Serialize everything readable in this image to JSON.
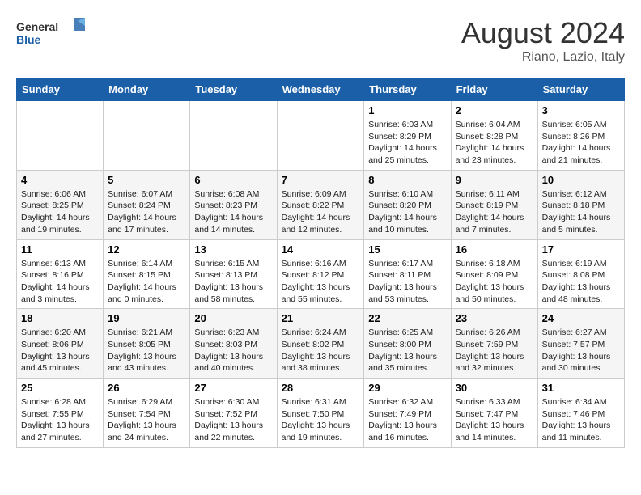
{
  "header": {
    "logo_general": "General",
    "logo_blue": "Blue",
    "month_title": "August 2024",
    "location": "Riano, Lazio, Italy"
  },
  "weekdays": [
    "Sunday",
    "Monday",
    "Tuesday",
    "Wednesday",
    "Thursday",
    "Friday",
    "Saturday"
  ],
  "weeks": [
    [
      {
        "day": "",
        "info": ""
      },
      {
        "day": "",
        "info": ""
      },
      {
        "day": "",
        "info": ""
      },
      {
        "day": "",
        "info": ""
      },
      {
        "day": "1",
        "info": "Sunrise: 6:03 AM\nSunset: 8:29 PM\nDaylight: 14 hours and 25 minutes."
      },
      {
        "day": "2",
        "info": "Sunrise: 6:04 AM\nSunset: 8:28 PM\nDaylight: 14 hours and 23 minutes."
      },
      {
        "day": "3",
        "info": "Sunrise: 6:05 AM\nSunset: 8:26 PM\nDaylight: 14 hours and 21 minutes."
      }
    ],
    [
      {
        "day": "4",
        "info": "Sunrise: 6:06 AM\nSunset: 8:25 PM\nDaylight: 14 hours and 19 minutes."
      },
      {
        "day": "5",
        "info": "Sunrise: 6:07 AM\nSunset: 8:24 PM\nDaylight: 14 hours and 17 minutes."
      },
      {
        "day": "6",
        "info": "Sunrise: 6:08 AM\nSunset: 8:23 PM\nDaylight: 14 hours and 14 minutes."
      },
      {
        "day": "7",
        "info": "Sunrise: 6:09 AM\nSunset: 8:22 PM\nDaylight: 14 hours and 12 minutes."
      },
      {
        "day": "8",
        "info": "Sunrise: 6:10 AM\nSunset: 8:20 PM\nDaylight: 14 hours and 10 minutes."
      },
      {
        "day": "9",
        "info": "Sunrise: 6:11 AM\nSunset: 8:19 PM\nDaylight: 14 hours and 7 minutes."
      },
      {
        "day": "10",
        "info": "Sunrise: 6:12 AM\nSunset: 8:18 PM\nDaylight: 14 hours and 5 minutes."
      }
    ],
    [
      {
        "day": "11",
        "info": "Sunrise: 6:13 AM\nSunset: 8:16 PM\nDaylight: 14 hours and 3 minutes."
      },
      {
        "day": "12",
        "info": "Sunrise: 6:14 AM\nSunset: 8:15 PM\nDaylight: 14 hours and 0 minutes."
      },
      {
        "day": "13",
        "info": "Sunrise: 6:15 AM\nSunset: 8:13 PM\nDaylight: 13 hours and 58 minutes."
      },
      {
        "day": "14",
        "info": "Sunrise: 6:16 AM\nSunset: 8:12 PM\nDaylight: 13 hours and 55 minutes."
      },
      {
        "day": "15",
        "info": "Sunrise: 6:17 AM\nSunset: 8:11 PM\nDaylight: 13 hours and 53 minutes."
      },
      {
        "day": "16",
        "info": "Sunrise: 6:18 AM\nSunset: 8:09 PM\nDaylight: 13 hours and 50 minutes."
      },
      {
        "day": "17",
        "info": "Sunrise: 6:19 AM\nSunset: 8:08 PM\nDaylight: 13 hours and 48 minutes."
      }
    ],
    [
      {
        "day": "18",
        "info": "Sunrise: 6:20 AM\nSunset: 8:06 PM\nDaylight: 13 hours and 45 minutes."
      },
      {
        "day": "19",
        "info": "Sunrise: 6:21 AM\nSunset: 8:05 PM\nDaylight: 13 hours and 43 minutes."
      },
      {
        "day": "20",
        "info": "Sunrise: 6:23 AM\nSunset: 8:03 PM\nDaylight: 13 hours and 40 minutes."
      },
      {
        "day": "21",
        "info": "Sunrise: 6:24 AM\nSunset: 8:02 PM\nDaylight: 13 hours and 38 minutes."
      },
      {
        "day": "22",
        "info": "Sunrise: 6:25 AM\nSunset: 8:00 PM\nDaylight: 13 hours and 35 minutes."
      },
      {
        "day": "23",
        "info": "Sunrise: 6:26 AM\nSunset: 7:59 PM\nDaylight: 13 hours and 32 minutes."
      },
      {
        "day": "24",
        "info": "Sunrise: 6:27 AM\nSunset: 7:57 PM\nDaylight: 13 hours and 30 minutes."
      }
    ],
    [
      {
        "day": "25",
        "info": "Sunrise: 6:28 AM\nSunset: 7:55 PM\nDaylight: 13 hours and 27 minutes."
      },
      {
        "day": "26",
        "info": "Sunrise: 6:29 AM\nSunset: 7:54 PM\nDaylight: 13 hours and 24 minutes."
      },
      {
        "day": "27",
        "info": "Sunrise: 6:30 AM\nSunset: 7:52 PM\nDaylight: 13 hours and 22 minutes."
      },
      {
        "day": "28",
        "info": "Sunrise: 6:31 AM\nSunset: 7:50 PM\nDaylight: 13 hours and 19 minutes."
      },
      {
        "day": "29",
        "info": "Sunrise: 6:32 AM\nSunset: 7:49 PM\nDaylight: 13 hours and 16 minutes."
      },
      {
        "day": "30",
        "info": "Sunrise: 6:33 AM\nSunset: 7:47 PM\nDaylight: 13 hours and 14 minutes."
      },
      {
        "day": "31",
        "info": "Sunrise: 6:34 AM\nSunset: 7:46 PM\nDaylight: 13 hours and 11 minutes."
      }
    ]
  ]
}
